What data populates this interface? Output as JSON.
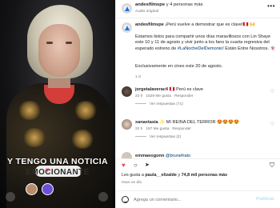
{
  "post": {
    "username": "andesfilmspe",
    "time_ago": "4 personas más",
    "connector": "y",
    "audio": "Audio original",
    "more": "•••"
  },
  "video_caption": {
    "line1": "Y TENGO UNA NOTICIA",
    "line2": "EMOCIONANTE"
  },
  "caption": {
    "username": "andesfilmspe",
    "intro": "¡Perú vuelve a demostrar que es clave!🇵🇪 🙌",
    "paragraph": "Estamos listos para compartir unos días maravillosos con Lin Shaye este 10 y 11 de agosto y vivir junto a los fans la cuarta regresiva del esperado estreno de",
    "hashtag": "#LaNocheDelDemonio",
    "paragraph_end": "! Están Entre Nosotros. 👻",
    "exclusive": "Exclusivamente en cines este 20 de agosto.",
    "age": "1 d"
  },
  "comments": [
    {
      "username": "jorgetalaverac4",
      "text": "🇵🇪 Perú es clave",
      "age": "23 h",
      "likes": "1529 Me gusta",
      "reply": "Responder",
      "replies": "Ver respuestas (71)",
      "liked": false
    },
    {
      "username": "xanaxtasia",
      "text": "✨ MI REINA DEL TERROR 😍😍😍😍",
      "age": "22 h",
      "likes": "157 Me gusta",
      "reply": "Responder",
      "replies": "Ver respuestas (2)",
      "liked": false
    },
    {
      "username": "emmaeogonn",
      "text": "@brunefrato",
      "age": "",
      "likes": "",
      "reply": "",
      "replies": "",
      "liked": false
    }
  ],
  "likes": {
    "prefix": "Les gusta a",
    "user": "paula__elizalde",
    "suffix": "y",
    "others": "74,8 mil personas más"
  },
  "time_label": "Hace un día",
  "comment_box": {
    "placeholder": "Agrega un comentario...",
    "post_label": "Publicar"
  },
  "colors": {
    "accent": "#0095f6",
    "like_red": "#ed4956",
    "link": "#00376b"
  }
}
